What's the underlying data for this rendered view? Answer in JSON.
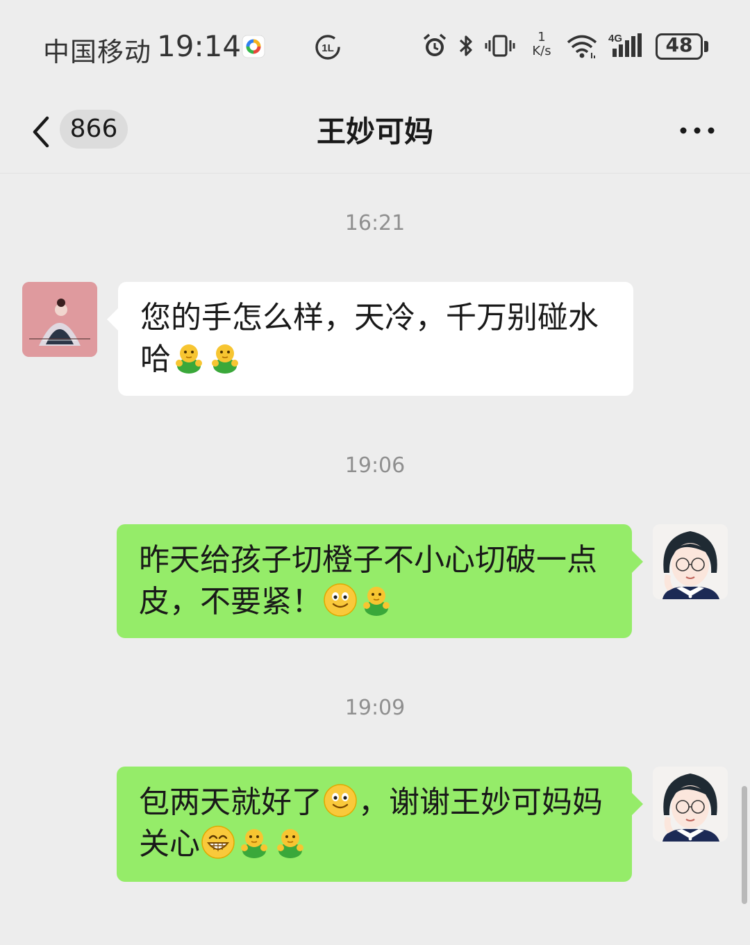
{
  "status_bar": {
    "carrier": "中国移动",
    "time": "19:14",
    "net_speed_value": "1",
    "net_speed_unit": "K/s",
    "network_type": "4G",
    "battery_level": "48"
  },
  "header": {
    "unread_count": "866",
    "title": "王妙可妈"
  },
  "messages": [
    {
      "timestamp": "16:21",
      "side": "left",
      "text_line1": "您的手怎么样，天冷，千万别碰水",
      "text_line2": "哈",
      "emojis": [
        "hug-emoji",
        "hug-emoji"
      ]
    },
    {
      "timestamp": "19:06",
      "side": "right",
      "text_line1": "昨天给孩子切橙子不小心切破一点",
      "text_line2": "皮，不要紧！",
      "emojis": [
        "smile-emoji",
        "hug-emoji"
      ]
    },
    {
      "timestamp": "19:09",
      "side": "right",
      "text_part1": "包两天就好了",
      "text_part2": "，谢谢王妙可妈妈",
      "text_part3": "关心",
      "emojis": [
        "smile-emoji",
        "grin-emoji",
        "hug-emoji",
        "hug-emoji"
      ]
    }
  ],
  "colors": {
    "background": "#ededed",
    "sent_bubble": "#95ec69",
    "received_bubble": "#ffffff",
    "timestamp": "#8f8f8f"
  }
}
